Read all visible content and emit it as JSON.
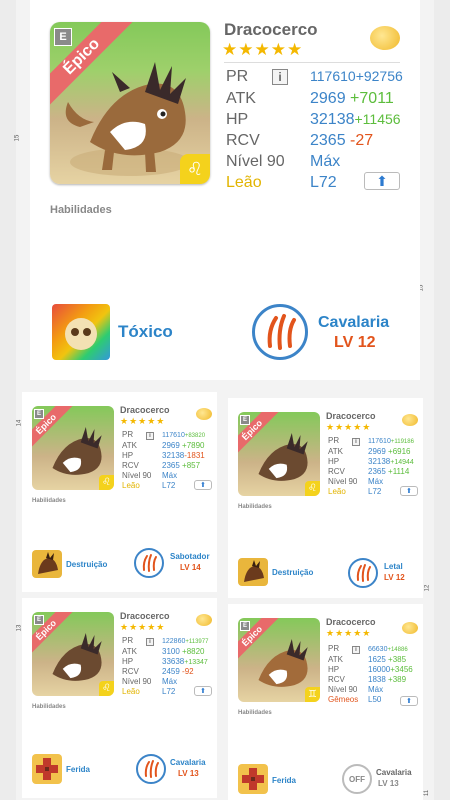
{
  "main": {
    "rarity": "Épico",
    "badge": "E",
    "name": "Dracocerco",
    "stars": "★★★★★",
    "rows": [
      {
        "label": "PR",
        "info": "i",
        "value": "117610",
        "bonus": "+92756"
      },
      {
        "label": "ATK",
        "value": "2969",
        "bonus": "+7011"
      },
      {
        "label": "HP",
        "value": "32138",
        "bonus": "+11456"
      },
      {
        "label": "RCV",
        "value": "2365",
        "bonus": "-27"
      }
    ],
    "level_label": "Nível 90",
    "level_value": "Máx",
    "sign": "Leão",
    "sign_level": "L72",
    "skills_header": "Habilidades",
    "skill1": {
      "name": "Tóxico"
    },
    "skill2": {
      "name": "Cavalaria",
      "level": "LV 12"
    }
  },
  "cards": [
    {
      "name": "Dracocerco",
      "rarity": "Épico",
      "badge": "E",
      "stars": "★★★★★",
      "pr": "117610",
      "pr_bonus": "+83820",
      "atk": "2969",
      "atk_bonus": "+7890",
      "hp": "32138",
      "hp_bonus": "-1831",
      "rcv": "2365",
      "rcv_bonus": "+857",
      "level_label": "Nível 90",
      "level_value": "Máx",
      "sign": "Leão",
      "sign_level": "L72",
      "skills_header": "Habilidades",
      "skill1": "Destruição",
      "skill2": "Sabotador",
      "skill2_level": "LV 14"
    },
    {
      "name": "Dracocerco",
      "rarity": "Épico",
      "badge": "E",
      "stars": "★★★★★",
      "pr": "117610",
      "pr_bonus": "+119186",
      "atk": "2969",
      "atk_bonus": "+6916",
      "hp": "32138",
      "hp_bonus": "+14944",
      "rcv": "2365",
      "rcv_bonus": "+1114",
      "level_label": "Nível 90",
      "level_value": "Máx",
      "sign": "Leão",
      "sign_level": "L72",
      "skills_header": "Habilidades",
      "skill1": "Destruição",
      "skill2": "Letal",
      "skill2_level": "LV 12"
    },
    {
      "name": "Dracocerco",
      "rarity": "Épico",
      "badge": "E",
      "stars": "★★★★★",
      "pr": "122860",
      "pr_bonus": "+113977",
      "atk": "3100",
      "atk_bonus": "+8820",
      "hp": "33638",
      "hp_bonus": "+13347",
      "rcv": "2459",
      "rcv_bonus": "-92",
      "level_label": "Nível 90",
      "level_value": "Máx",
      "sign": "Leão",
      "sign_level": "L72",
      "skills_header": "Habilidades",
      "skill1": "Ferida",
      "skill2": "Cavalaria",
      "skill2_level": "LV 13"
    },
    {
      "name": "Dracocerco",
      "rarity": "Épico",
      "badge": "E",
      "stars": "★★★★★",
      "pr": "66630",
      "pr_bonus": "+14886",
      "atk": "1625",
      "atk_bonus": "+385",
      "hp": "16000",
      "hp_bonus": "+3456",
      "rcv": "1838",
      "rcv_bonus": "+389",
      "level_label": "Nível 90",
      "level_value": "Máx",
      "sign": "Gêmeos",
      "sign_level": "L50",
      "skills_header": "Habilidades",
      "skill1": "Ferida",
      "skill2": "Cavalaria",
      "skill2_level": "LV 13",
      "off_label": "OFF"
    }
  ],
  "page_numbers": {
    "p15a": "15",
    "p15b": "15",
    "p14": "14",
    "p12": "12",
    "p13": "13",
    "p11": "11"
  },
  "colors": {
    "accent_blue": "#3c84c8",
    "bonus_green": "#5cbd3c",
    "penalty_orange": "#e2541c",
    "rarity_red": "#e86a6a",
    "sign_yellow": "#f4d21c"
  }
}
